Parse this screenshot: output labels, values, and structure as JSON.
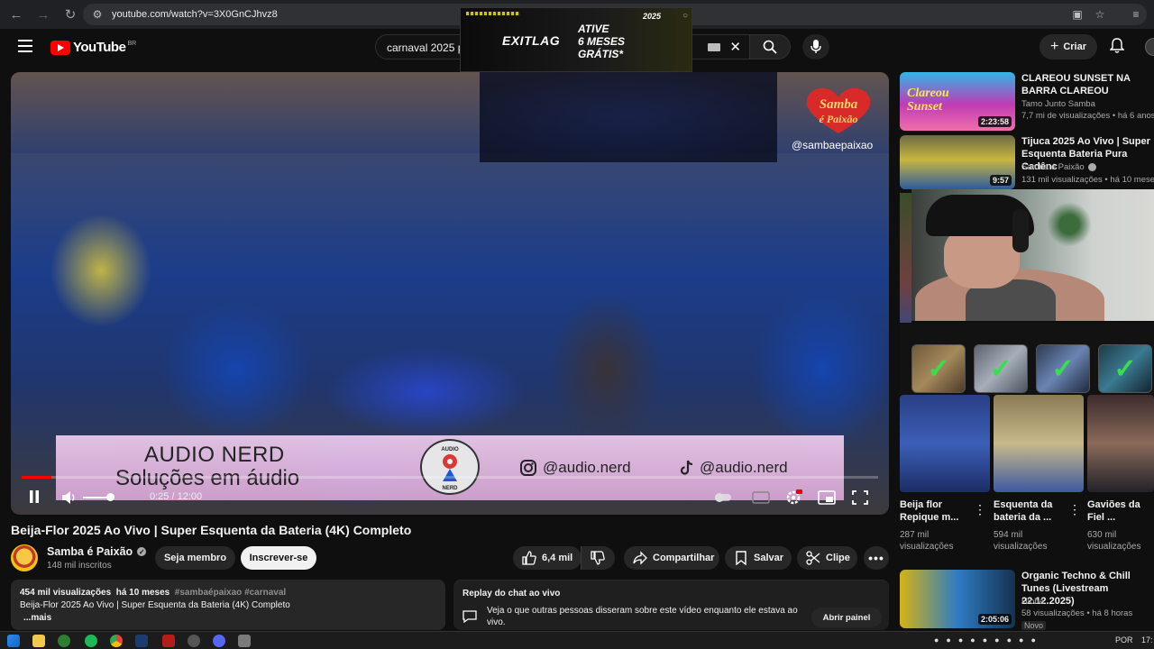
{
  "browser": {
    "url": "youtube.com/watch?v=3X0GnCJhvz8"
  },
  "ad": {
    "brand": "EXITLAG",
    "line1": "ATIVE",
    "line2": "6 MESES",
    "line3": "GRÁTIS*",
    "year": "2025"
  },
  "header": {
    "logo_text": "YouTube",
    "country": "BR",
    "search_query": "carnaval 2025 p",
    "create_label": "Criar"
  },
  "player": {
    "watermark": "@sambaepaixao",
    "banner_line1": "AUDIO NERD",
    "banner_line2": "Soluções em áudio",
    "instagram": "@audio.nerd",
    "tiktok": "@audio.nerd",
    "logo_top": "AUDIO",
    "logo_bottom": "NERD",
    "time": "0:25 / 12:00",
    "progress_fraction": 0.035,
    "samba_logo_line1": "Samba",
    "samba_logo_line2": "é Paixão"
  },
  "video": {
    "title": "Beija-Flor 2025 Ao Vivo | Super Esquenta da Bateria (4K) Completo",
    "channel": "Samba é Paixão",
    "subscribers": "148 mil inscritos",
    "join_label": "Seja membro",
    "subscribe_label": "Inscrever-se",
    "likes": "6,4 mil",
    "share_label": "Compartilhar",
    "save_label": "Salvar",
    "clip_label": "Clipe"
  },
  "description": {
    "views": "454 mil visualizações",
    "age": "há 10 meses",
    "tags": "#sambaépaixao #carnaval",
    "line": "Beija-Flor 2025 Ao Vivo | Super Esquenta da Bateria (4K) Completo",
    "more": "...mais"
  },
  "chat": {
    "heading": "Replay do chat ao vivo",
    "text": "Veja o que outras pessoas disseram sobre este vídeo enquanto ele estava ao vivo.",
    "open_label": "Abrir painel"
  },
  "recommendations": [
    {
      "title": "CLAREOU SUNSET NA BARRA CLAREOU",
      "channel": "Tamo Junto Samba",
      "stats": "7,7 mi de visualizações • há 6 anos",
      "duration": "2:23:58",
      "thumb_text": "Clareou Sunset"
    },
    {
      "title": "Tijuca 2025 Ao Vivo | Super Esquenta Bateria Pura Cadênc",
      "channel": "Samba é Paixão",
      "stats": "131 mil visualizações • há 10 meses",
      "duration": "9:57"
    },
    {
      "title": "Organic Techno & Chill Tunes (Livestream 22.12.2025)",
      "channel": "Hioba",
      "stats": "58 visualizações • há 8 horas",
      "duration": "2:05:06",
      "badge": "Novo"
    }
  ],
  "shorts": [
    {
      "title": "Beija flor Repique m...",
      "stats1": "287 mil",
      "stats2": "visualizações"
    },
    {
      "title": "Esquenta da bateria da ...",
      "stats1": "594 mil",
      "stats2": "visualizações"
    },
    {
      "title": "Gaviões da Fiel ...",
      "stats1": "630 mil",
      "stats2": "visualizações"
    }
  ],
  "taskbar": {
    "lang": "POR",
    "clock": "17:"
  },
  "colors": {
    "brand_red": "#ff0000",
    "background": "#0f0f0f",
    "surface": "#272727",
    "check_green": "#35e04a"
  }
}
